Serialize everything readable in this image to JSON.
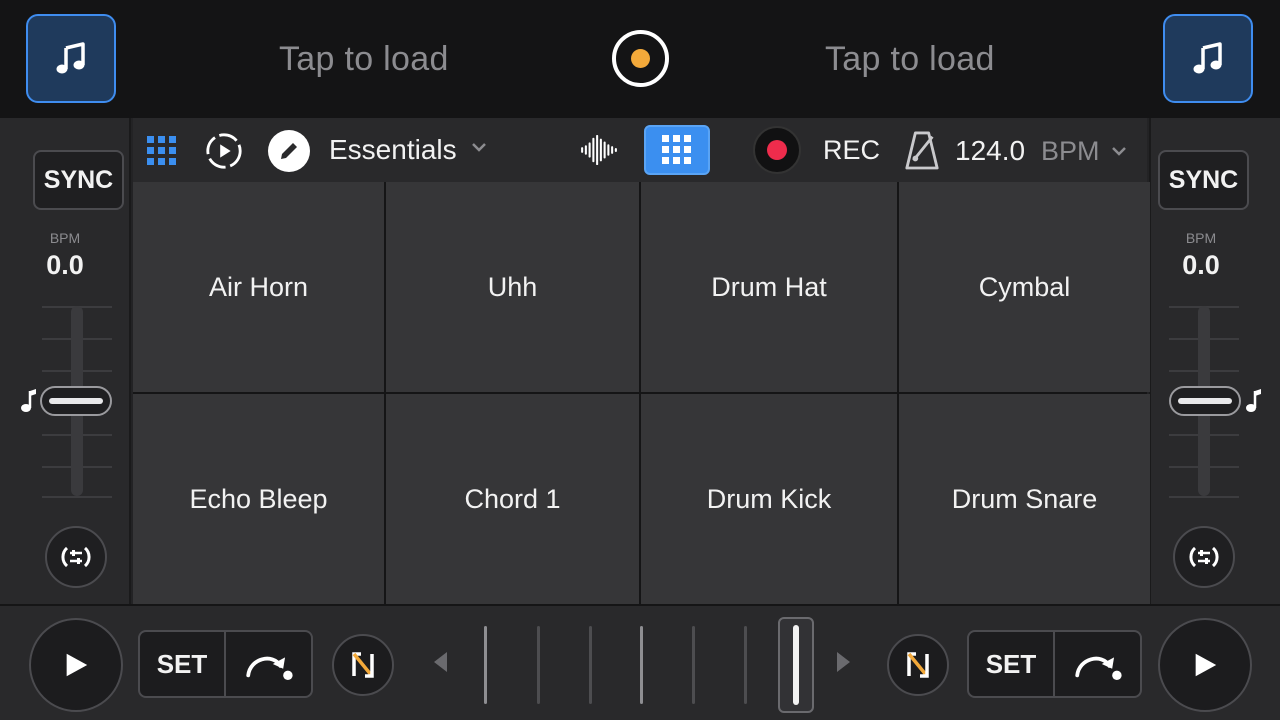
{
  "top": {
    "deck_a_load": "Tap to load",
    "deck_b_load": "Tap to load"
  },
  "deck_a": {
    "sync_label": "SYNC",
    "bpm_label": "BPM",
    "bpm_value": "0.0"
  },
  "deck_b": {
    "sync_label": "SYNC",
    "bpm_label": "BPM",
    "bpm_value": "0.0"
  },
  "sampler": {
    "preset_name": "Essentials",
    "rec_label": "REC",
    "bpm_value": "124.0",
    "bpm_unit": "BPM",
    "pads": [
      "Air Horn",
      "Uhh",
      "Drum Hat",
      "Cymbal",
      "Echo Bleep",
      "Chord 1",
      "Drum Kick",
      "Drum Snare"
    ]
  },
  "bottom": {
    "deck_a_set": "SET",
    "deck_b_set": "SET"
  },
  "colors": {
    "accent_blue": "#3b8ff0",
    "record_red": "#ee2c4c",
    "logo_orange": "#f3a93a"
  }
}
